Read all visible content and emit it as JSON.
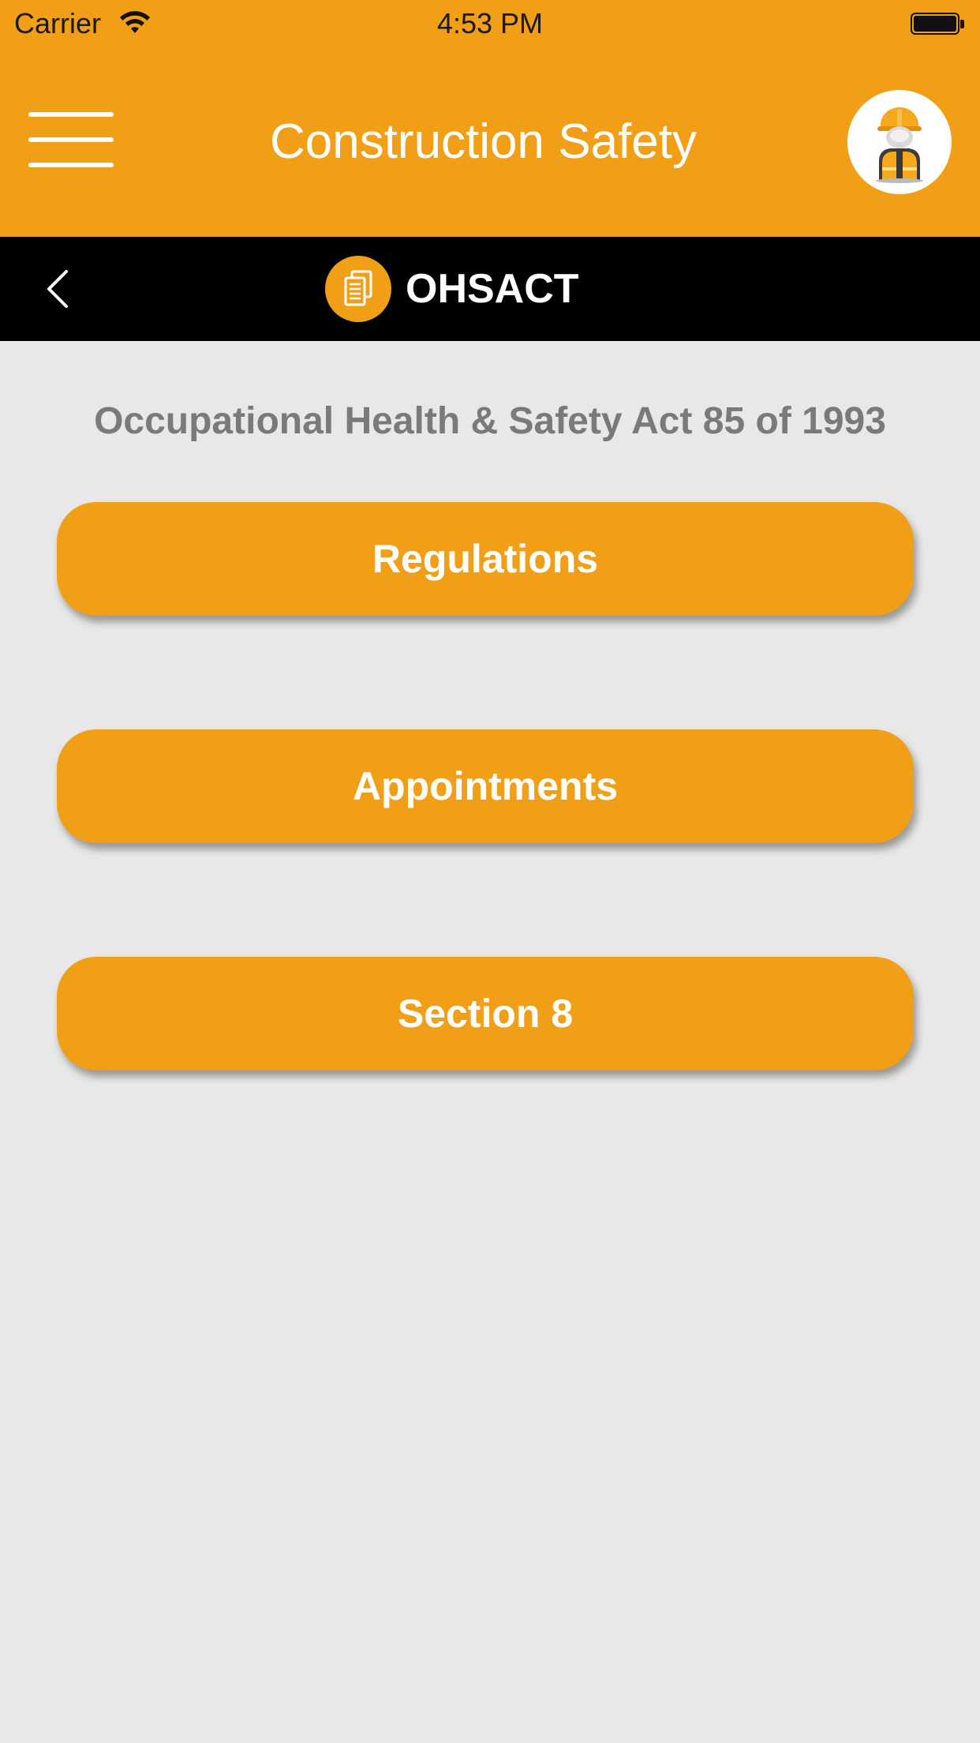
{
  "status_bar": {
    "carrier": "Carrier",
    "time": "4:53 PM"
  },
  "header": {
    "title": "Construction Safety",
    "menu_icon": "hamburger-menu-icon",
    "avatar_icon": "construction-worker-icon"
  },
  "subnav": {
    "back_icon": "chevron-left-icon",
    "section_icon": "documents-icon",
    "title": "OHSACT"
  },
  "main": {
    "subtitle": "Occupational Health & Safety Act 85 of 1993",
    "buttons": [
      {
        "label": "Regulations"
      },
      {
        "label": "Appointments"
      },
      {
        "label": "Section 8"
      }
    ]
  },
  "colors": {
    "accent": "#F29F18",
    "subnav_background": "#000000",
    "page_background": "#E8E8E8",
    "subtitle_text": "#7A7A7A"
  }
}
